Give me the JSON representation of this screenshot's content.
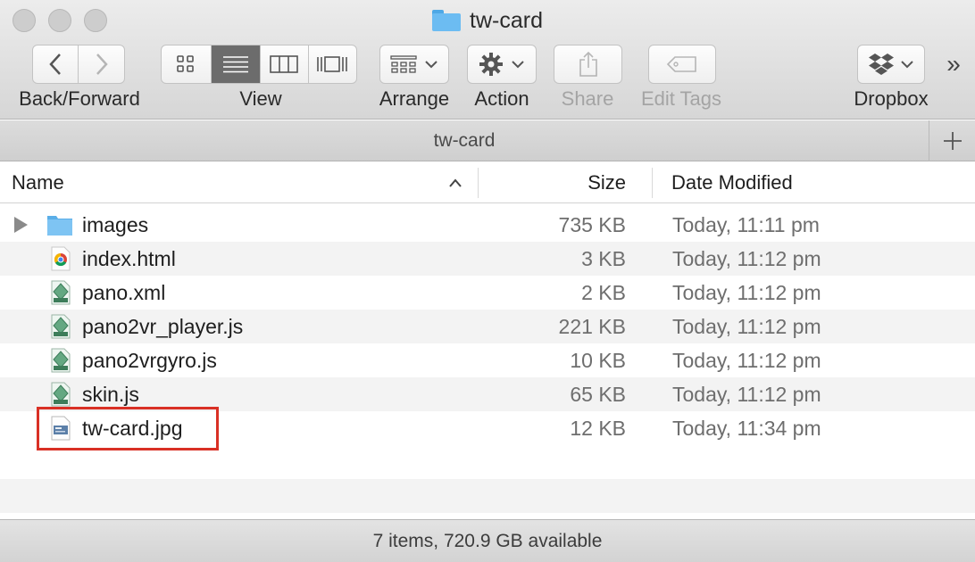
{
  "window": {
    "title": "tw-card",
    "folder_icon": "folder-icon"
  },
  "toolbar": {
    "back_forward_label": "Back/Forward",
    "view_label": "View",
    "arrange_label": "Arrange",
    "action_label": "Action",
    "share_label": "Share",
    "edit_tags_label": "Edit Tags",
    "dropbox_label": "Dropbox",
    "overflow": "»",
    "active_view": "list"
  },
  "pathbar": {
    "title": "tw-card"
  },
  "columns": {
    "name": "Name",
    "size": "Size",
    "date": "Date Modified"
  },
  "files": [
    {
      "name": "images",
      "size": "735 KB",
      "date": "Today, 11:11 pm",
      "icon": "folder-icon",
      "expandable": true
    },
    {
      "name": "index.html",
      "size": "3 KB",
      "date": "Today, 11:12 pm",
      "icon": "chrome-icon"
    },
    {
      "name": "pano.xml",
      "size": "2 KB",
      "date": "Today, 11:12 pm",
      "icon": "text-file-icon"
    },
    {
      "name": "pano2vr_player.js",
      "size": "221 KB",
      "date": "Today, 11:12 pm",
      "icon": "text-file-icon"
    },
    {
      "name": "pano2vrgyro.js",
      "size": "10 KB",
      "date": "Today, 11:12 pm",
      "icon": "text-file-icon"
    },
    {
      "name": "skin.js",
      "size": "65 KB",
      "date": "Today, 11:12 pm",
      "icon": "text-file-icon"
    },
    {
      "name": "tw-card.jpg",
      "size": "12 KB",
      "date": "Today, 11:34 pm",
      "icon": "image-file-icon",
      "highlighted": true
    }
  ],
  "status": {
    "text": "7 items, 720.9 GB available"
  },
  "colors": {
    "highlight": "#d93025",
    "folder": "#6cbcf2"
  }
}
